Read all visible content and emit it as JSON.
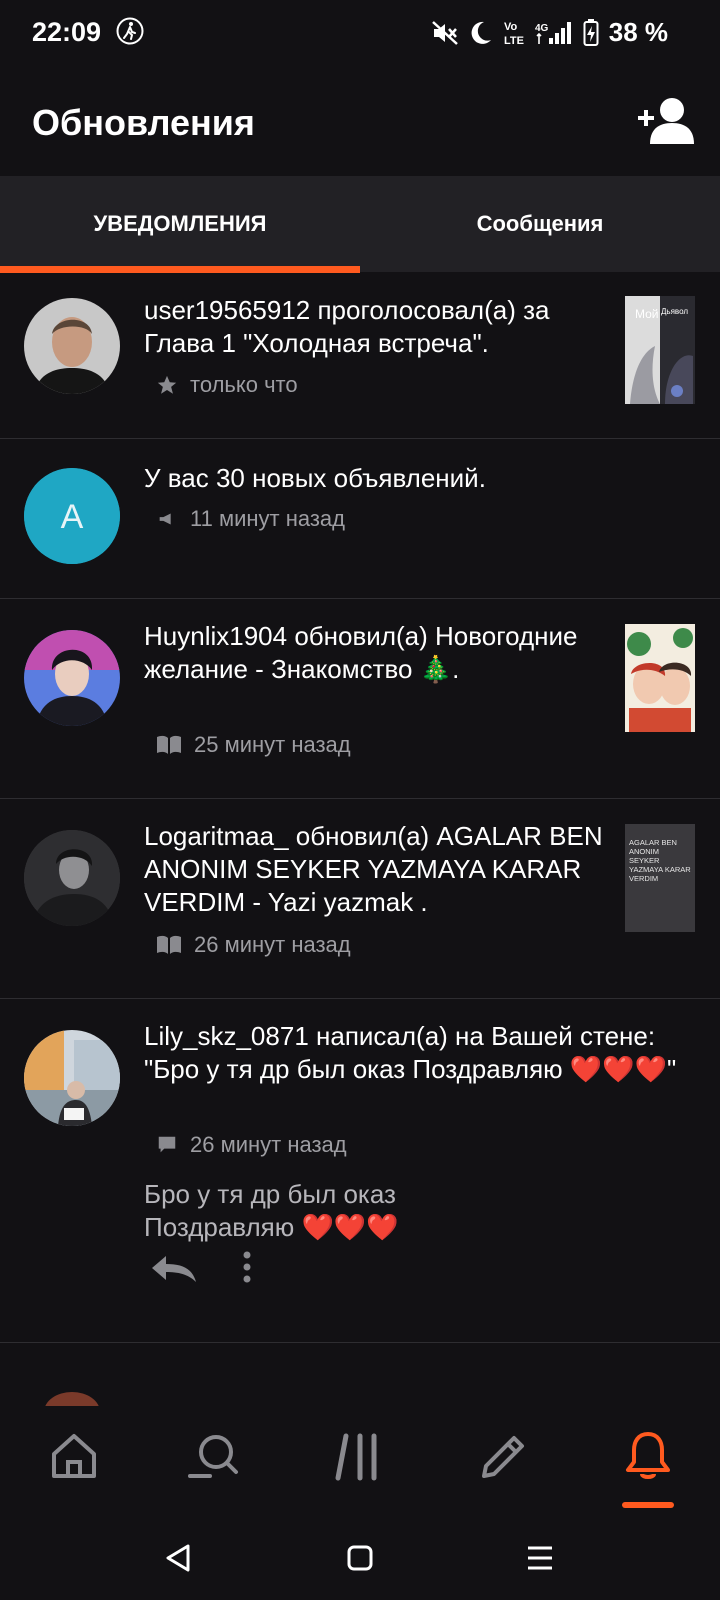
{
  "status_bar": {
    "time": "22:09",
    "battery": "38 %",
    "icons": [
      "running-icon",
      "mute-icon",
      "moon-icon",
      "volte-icon",
      "signal-icon",
      "battery-icon"
    ]
  },
  "header": {
    "title": "Обновления",
    "add_friend_icon": "add-friend-icon"
  },
  "tabs": [
    {
      "label": "УВЕДОМЛЕНИЯ",
      "active": true
    },
    {
      "label": "Сообщения",
      "active": false
    }
  ],
  "notifications": [
    {
      "text": "user19565912 проголосовал(а) за Глава 1 \"Холодная встреча\".",
      "time": "только что",
      "icon": "star-icon"
    },
    {
      "text": "У вас 30 новых объявлений.",
      "time": "11 минут назад",
      "icon": "megaphone-icon",
      "avatar_letter": "A"
    },
    {
      "text": "Huynlix1904 обновил(а) Новогодние желание - Знакомство 🎄.",
      "time": "25 минут назад",
      "icon": "book-icon"
    },
    {
      "text": "Logaritmaa_ обновил(а) AGALAR BEN ANONIM SEYKER YAZMAYA KARAR VERDIM - Yazi yazmak .",
      "time": "26 минут назад",
      "icon": "book-icon"
    },
    {
      "text": "Lily_skz_0871 написал(а) на Вашей стене: \"Бро у тя др был оказ Поздравляю ❤️❤️❤️\"",
      "time": "26 минут назад",
      "icon": "comment-icon",
      "wall_text": "Бро у тя др был оказ Поздравляю ❤️❤️❤️"
    }
  ],
  "thumbs": {
    "cover1_top": "Мой",
    "cover1_top2": "Дьявол",
    "cover4_lines": "AGALAR BEN ANONIM SEYKER YAZMAYA KARAR VERDIM"
  },
  "bottom_nav": [
    "home-icon",
    "search-icon",
    "library-icon",
    "write-icon",
    "notifications-icon"
  ],
  "colors": {
    "accent": "#ff5a1f",
    "background": "#121114",
    "tabbar": "#222125"
  }
}
